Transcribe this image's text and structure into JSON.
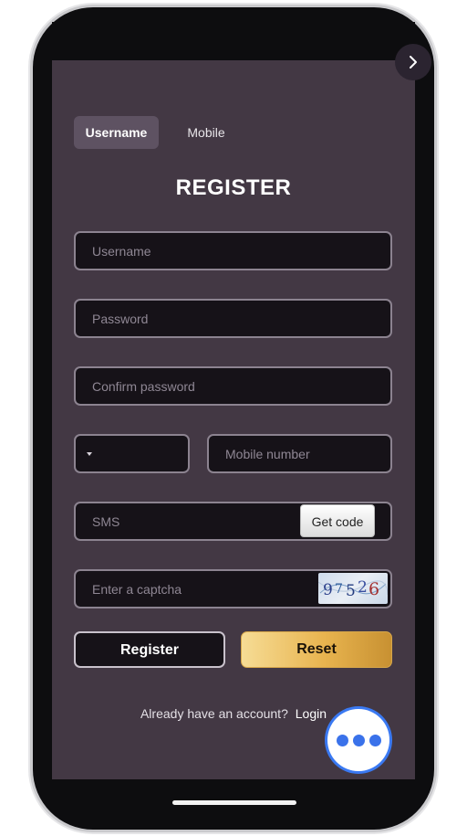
{
  "tabs": {
    "username": "Username",
    "mobile": "Mobile"
  },
  "title": "REGISTER",
  "fields": {
    "username_placeholder": "Username",
    "password_placeholder": "Password",
    "confirm_placeholder": "Confirm password",
    "mobile_placeholder": "Mobile number",
    "sms_placeholder": "SMS",
    "captcha_placeholder": "Enter a captcha"
  },
  "get_code_label": "Get code",
  "captcha_text": "97526",
  "buttons": {
    "register": "Register",
    "reset": "Reset"
  },
  "login_prompt": {
    "question": "Already have an account?",
    "link": "Login"
  },
  "colors": {
    "background": "#433844",
    "field_bg": "#161218",
    "accent_gold": "#e8b44f",
    "chat_blue": "#3a72ea"
  },
  "icons": {
    "top_right": "chevron-right-icon",
    "dropdown": "caret-down-icon",
    "chat": "chat-dots-icon"
  }
}
